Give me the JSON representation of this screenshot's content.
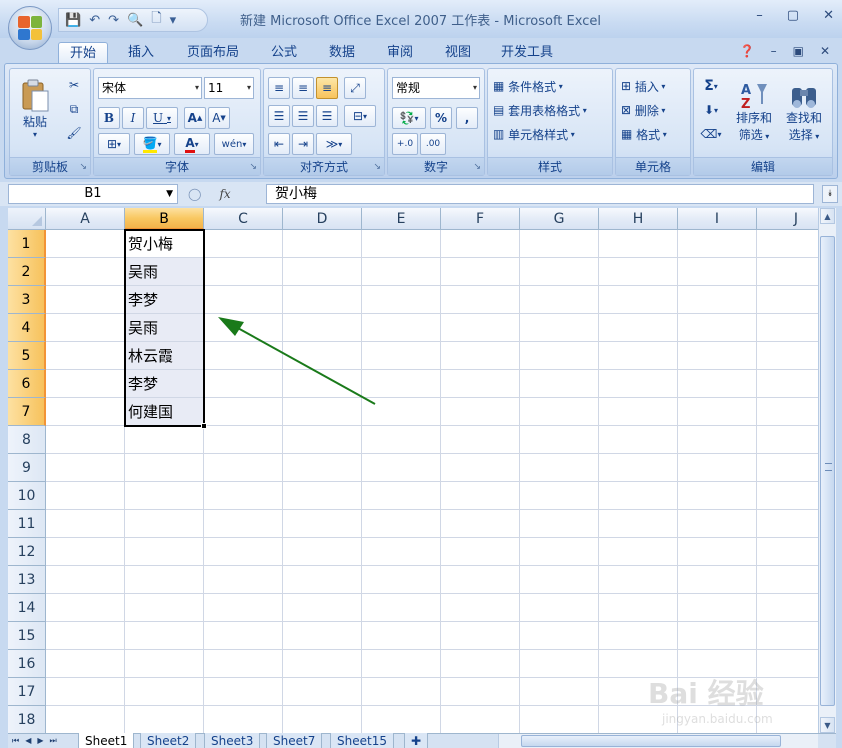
{
  "window": {
    "title": "新建 Microsoft Office Excel 2007 工作表 - Microsoft Excel",
    "controls": [
      "–",
      "▢",
      "✕"
    ]
  },
  "ribbon_tabs": [
    "开始",
    "插入",
    "页面布局",
    "公式",
    "数据",
    "审阅",
    "视图",
    "开发工具"
  ],
  "active_tab": "开始",
  "groups": {
    "clipboard": {
      "label": "剪贴板",
      "paste": "粘贴"
    },
    "font": {
      "label": "字体",
      "font_name": "宋体",
      "font_size": "11",
      "bold": "B",
      "italic": "I",
      "underline": "U",
      "wen": "wén"
    },
    "alignment": {
      "label": "对齐方式"
    },
    "number": {
      "label": "数字",
      "format": "常规",
      "percent": "%",
      "comma": ","
    },
    "styles": {
      "label": "样式",
      "conditional": "条件格式",
      "table": "套用表格格式",
      "cell_styles": "单元格样式"
    },
    "cells": {
      "label": "单元格",
      "insert": "插入",
      "delete": "删除",
      "format": "格式"
    },
    "editing": {
      "label": "编辑",
      "sort1": "排序和",
      "sort2": "筛选",
      "find1": "查找和",
      "find2": "选择"
    }
  },
  "formula_bar": {
    "name_box": "B1",
    "fx": "fx",
    "value": "贺小梅"
  },
  "columns": [
    "A",
    "B",
    "C",
    "D",
    "E",
    "F",
    "G",
    "H",
    "I",
    "J"
  ],
  "rows": [
    "1",
    "2",
    "3",
    "4",
    "5",
    "6",
    "7",
    "8",
    "9",
    "10",
    "11",
    "12",
    "13",
    "14",
    "15",
    "16",
    "17",
    "18"
  ],
  "cells_b": [
    "贺小梅",
    "吴雨",
    "李梦",
    "吴雨",
    "林云霞",
    "李梦",
    "何建国"
  ],
  "sheets": [
    "Sheet1",
    "Sheet2",
    "Sheet3",
    "Sheet7",
    "Sheet15"
  ],
  "active_sheet": "Sheet1",
  "annotation_arrow_color": "#1a7a1a",
  "watermark": {
    "brand": "Bai 经验",
    "url": "jingyan.baidu.com"
  }
}
